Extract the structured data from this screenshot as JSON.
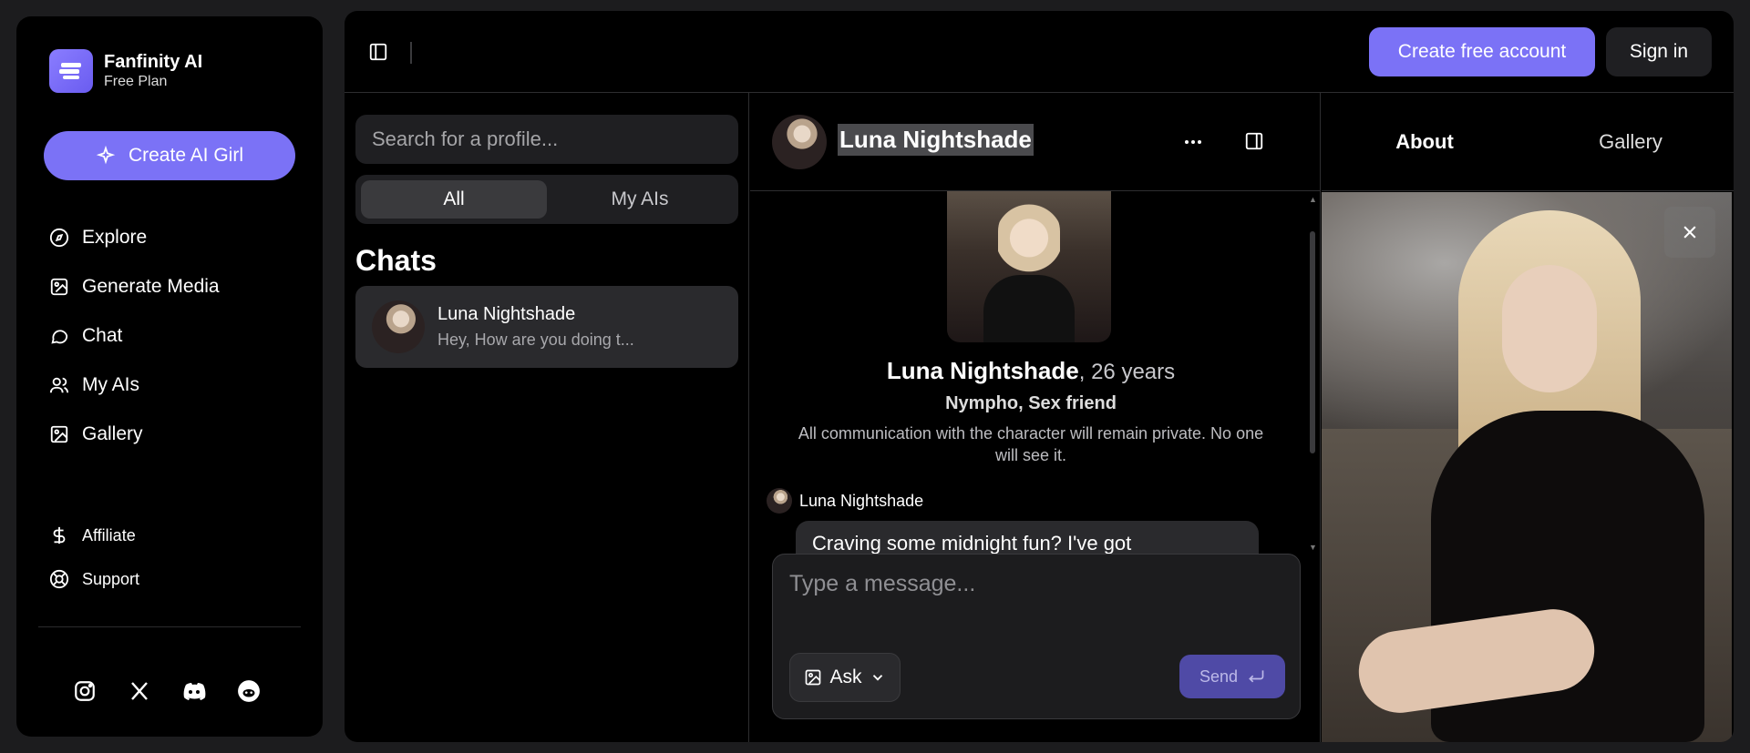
{
  "brand": {
    "name": "Fanfinity AI",
    "plan": "Free Plan"
  },
  "sidebar": {
    "create_label": "Create AI Girl",
    "items": [
      {
        "label": "Explore",
        "icon": "compass-icon"
      },
      {
        "label": "Generate Media",
        "icon": "media-icon"
      },
      {
        "label": "Chat",
        "icon": "chat-icon"
      },
      {
        "label": "My AIs",
        "icon": "users-icon"
      },
      {
        "label": "Gallery",
        "icon": "image-icon"
      }
    ],
    "secondary": [
      {
        "label": "Affiliate",
        "icon": "dollar-icon"
      },
      {
        "label": "Support",
        "icon": "lifebuoy-icon"
      }
    ],
    "socials": [
      "instagram-icon",
      "x-icon",
      "discord-icon",
      "reddit-icon"
    ]
  },
  "header": {
    "create_account": "Create free account",
    "sign_in": "Sign in"
  },
  "chatlist": {
    "search_placeholder": "Search for a profile...",
    "tabs": [
      "All",
      "My AIs"
    ],
    "section_title": "Chats",
    "items": [
      {
        "name": "Luna Nightshade",
        "preview": "Hey, How are you doing t..."
      }
    ]
  },
  "conversation": {
    "name": "Luna Nightshade",
    "profile_name": "Luna Nightshade",
    "profile_age": ", 26 years",
    "tags": "Nympho, Sex friend",
    "privacy": "All communication with the character will remain private. No one will see it.",
    "messages": [
      {
        "author": "Luna Nightshade",
        "text": "Craving some midnight fun? I've got"
      }
    ],
    "input_placeholder": "Type a message...",
    "ask_label": "Ask",
    "send_label": "Send"
  },
  "details": {
    "tabs": [
      "About",
      "Gallery"
    ]
  },
  "colors": {
    "accent": "#7b72f6",
    "send": "#4f4aa6",
    "panel": "#000000",
    "surface": "#1f1f22"
  }
}
